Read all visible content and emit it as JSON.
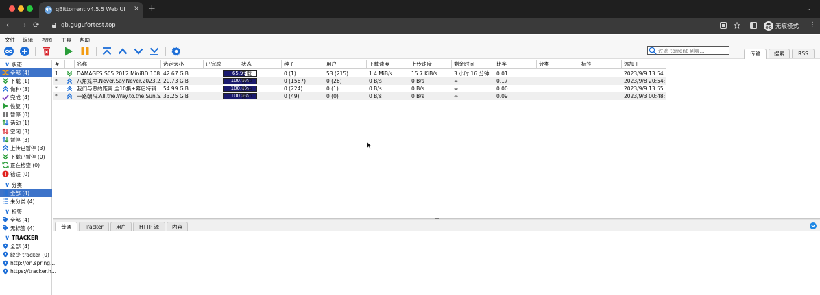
{
  "browser": {
    "tab_title": "qBittorrent v4.5.5 Web UI",
    "tab_favicon": "qB",
    "url": "qb.gugufortest.top",
    "incognito_label": "无痕模式",
    "new_tab_symbol": "+",
    "close_symbol": "×",
    "menu_symbol": "⋮",
    "tab_list_symbol": "⌄",
    "back_symbol": "←",
    "forward_symbol": "→",
    "reload_symbol": "⟳"
  },
  "menu": [
    "文件",
    "编辑",
    "视图",
    "工具",
    "帮助"
  ],
  "toolbar": {
    "filter_placeholder": "过滤 torrent 列表...",
    "view_tabs": [
      "传输",
      "搜索",
      "RSS"
    ]
  },
  "sidebar": {
    "status_title": "状态",
    "status_items": [
      {
        "label": "全部 (4)",
        "icon": "shuffle-icon"
      },
      {
        "label": "下载 (1)",
        "icon": "download-icon"
      },
      {
        "label": "做种 (3)",
        "icon": "upload-icon"
      },
      {
        "label": "完成 (4)",
        "icon": "check-icon"
      },
      {
        "label": "恢复 (4)",
        "icon": "play-icon"
      },
      {
        "label": "暂停 (0)",
        "icon": "pause-icon"
      },
      {
        "label": "活动 (1)",
        "icon": "active-arrows-icon"
      },
      {
        "label": "空闲 (3)",
        "icon": "inactive-arrows-icon"
      },
      {
        "label": "暂停 (3)",
        "icon": "stalled-arrows-icon"
      },
      {
        "label": "上传已暂停 (3)",
        "icon": "upload-stalled-icon"
      },
      {
        "label": "下载已暂停 (0)",
        "icon": "download-stalled-icon"
      },
      {
        "label": "正在检查 (0)",
        "icon": "checking-icon"
      },
      {
        "label": "错误 (0)",
        "icon": "error-icon"
      }
    ],
    "category_title": "分类",
    "category_items": [
      {
        "label": "全部 (4)",
        "icon": "list-icon"
      },
      {
        "label": "未分类 (4)",
        "icon": "list-icon"
      }
    ],
    "tags_title": "标签",
    "tag_items": [
      {
        "label": "全部 (4)",
        "icon": "tag-icon"
      },
      {
        "label": "无标签 (4)",
        "icon": "tag-icon"
      }
    ],
    "tracker_title": "TRACKER",
    "tracker_items": [
      {
        "label": "全部 (4)",
        "icon": "location-pin-icon"
      },
      {
        "label": "缺少 tracker (0)",
        "icon": "location-pin-icon"
      },
      {
        "label": "http://on.spring...",
        "icon": "location-pin-icon"
      },
      {
        "label": "https://tracker.h...",
        "icon": "location-pin-icon"
      }
    ]
  },
  "table": {
    "columns": [
      "#",
      "",
      "名称",
      "选定大小",
      "已完成",
      "状态",
      "种子",
      "用户",
      "下载速度",
      "上传速度",
      "剩余时间",
      "比率",
      "分类",
      "标签",
      "添加于"
    ],
    "rows": [
      {
        "num": "1",
        "icon": "download-icon",
        "name": "DAMAGES S05 2012 MiniBD 108...",
        "size": "42.67 GiB",
        "progress": 0.659,
        "progress_text": "65.9%",
        "state": "下载",
        "seeds": "0 (1)",
        "peers": "53 (215)",
        "dl": "1.4 MiB/s",
        "ul": "15.7 KiB/s",
        "eta": "3 小时 16 分钟",
        "ratio": "0.01",
        "category": "",
        "tags": "",
        "added": "2023/9/9 13:54:..."
      },
      {
        "num": "*",
        "icon": "upload-icon",
        "name": "八角笼中.Never.Say.Never.2023.2...",
        "size": "20.73 GiB",
        "progress": 1.0,
        "progress_text": "100.0%",
        "state": "做种",
        "seeds": "0 (1567)",
        "peers": "0 (26)",
        "dl": "0 B/s",
        "ul": "0 B/s",
        "eta": "∞",
        "ratio": "0.17",
        "category": "",
        "tags": "",
        "added": "2023/9/8 20:54:..."
      },
      {
        "num": "*",
        "icon": "upload-icon",
        "name": "我们与恶的距离.全10集+幕后特辑....",
        "size": "54.99 GiB",
        "progress": 1.0,
        "progress_text": "100.0%",
        "state": "做种",
        "seeds": "0 (224)",
        "peers": "0 (1)",
        "dl": "0 B/s",
        "ul": "0 B/s",
        "eta": "∞",
        "ratio": "0.00",
        "category": "",
        "tags": "",
        "added": "2023/9/9 13:55:..."
      },
      {
        "num": "*",
        "icon": "upload-icon",
        "name": "一路朝阳.All.the.Way.to.the.Sun.S...",
        "size": "33.25 GiB",
        "progress": 1.0,
        "progress_text": "100.0%",
        "state": "做种",
        "seeds": "0 (49)",
        "peers": "0 (0)",
        "dl": "0 B/s",
        "ul": "0 B/s",
        "eta": "∞",
        "ratio": "0.09",
        "category": "",
        "tags": "",
        "added": "2023/9/3 00:48:..."
      }
    ]
  },
  "details_tabs": [
    "普通",
    "Tracker",
    "用户",
    "HTTP 源",
    "内容"
  ],
  "colors": {
    "accent": "#1e6fd8",
    "selection": "#3d73c9",
    "progress": "#1a1a6e",
    "download_green": "#2a9d3a",
    "upload_blue": "#1e6fd8",
    "pause_orange": "#f39c12",
    "delete_red": "#d8282f",
    "error_red": "#e0201c"
  }
}
